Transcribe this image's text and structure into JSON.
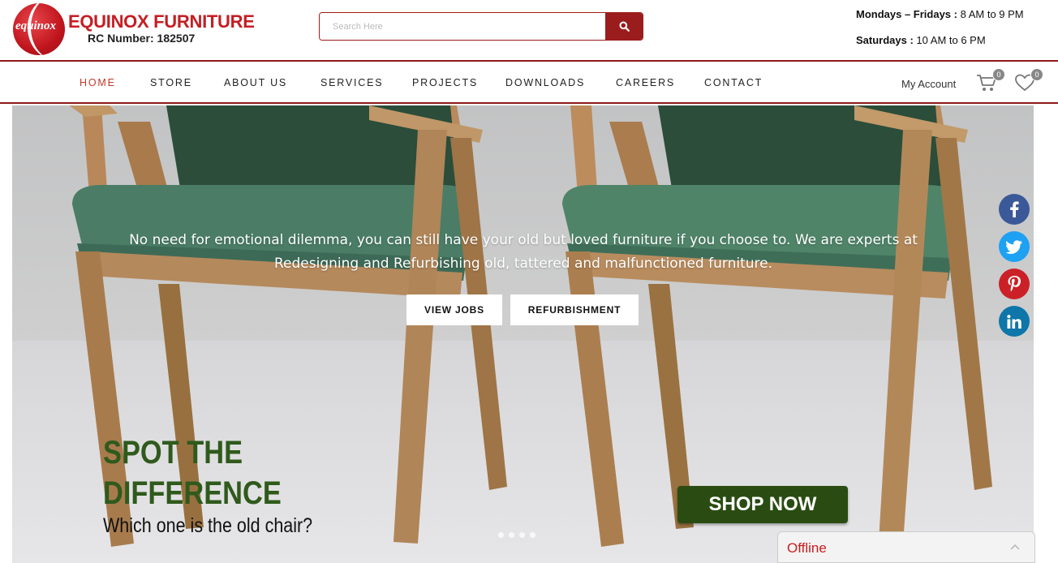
{
  "brand": {
    "logo_text": "equinox",
    "name": "EQUINOX FURNITURE",
    "rc_number": "RC Number: 182507",
    "color": "#c41e24"
  },
  "search": {
    "placeholder": "Search Here",
    "button_icon": "search-icon"
  },
  "hours": {
    "weekday_label": "Mondays – Fridays :",
    "weekday_time": " 8 AM to 9 PM",
    "saturday_label": "Saturdays :",
    "saturday_time": " 10 AM to 6 PM"
  },
  "nav": {
    "items": [
      {
        "label": "HOME",
        "active": true
      },
      {
        "label": "STORE"
      },
      {
        "label": "ABOUT US"
      },
      {
        "label": "SERVICES"
      },
      {
        "label": "PROJECTS"
      },
      {
        "label": "DOWNLOADS"
      },
      {
        "label": "CAREERS"
      },
      {
        "label": "CONTACT"
      }
    ],
    "account": "My Account",
    "cart_count": "0",
    "wishlist_count": "0",
    "active_color": "#c0392b"
  },
  "hero": {
    "text": "No need for emotional dilemma, you can still have your old but loved furniture if you choose to. We are experts at Redesigning and Refurbishing old, tattered and malfunctioned furniture.",
    "buttons": {
      "view_jobs": "VIEW JOBS",
      "refurbishment": "REFURBISHMENT"
    },
    "banner_title_line1": "SPOT THE",
    "banner_title_line2": "DIFFERENCE",
    "banner_subtitle": "Which one is the old chair?",
    "shop_button": "SHOP NOW",
    "slide_count": 4,
    "colors": {
      "title": "#2f5a1c",
      "shop": "#2a4c12"
    }
  },
  "social": [
    {
      "icon": "facebook-icon",
      "color": "#3b5998"
    },
    {
      "icon": "twitter-icon",
      "color": "#1da1f2"
    },
    {
      "icon": "pinterest-icon",
      "color": "#cb2027"
    },
    {
      "icon": "linkedin-icon",
      "color": "#0e76a8"
    }
  ],
  "chat": {
    "status": "Offline"
  }
}
